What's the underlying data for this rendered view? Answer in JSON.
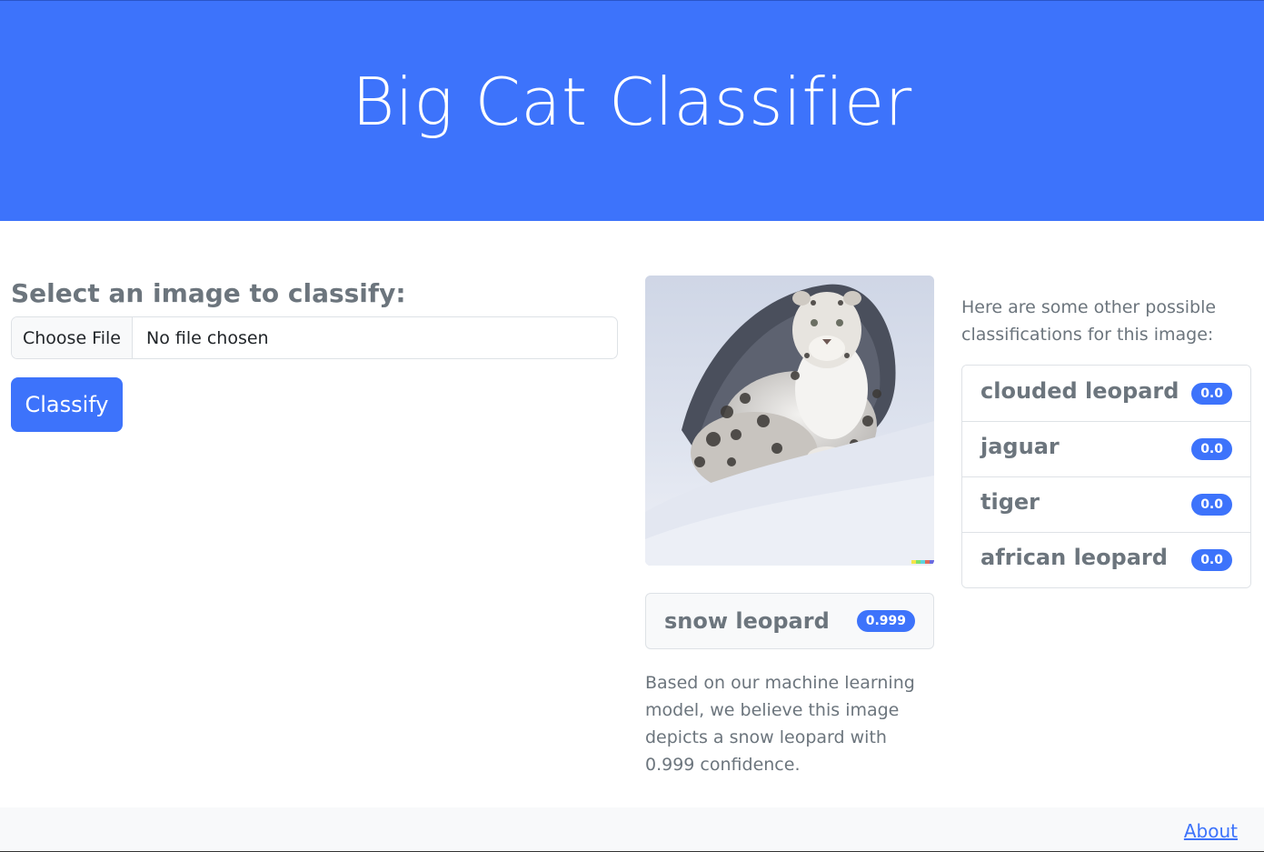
{
  "header": {
    "title": "Big Cat Classifier"
  },
  "upload": {
    "label": "Select an image to classify:",
    "choose_file_label": "Choose File",
    "file_status": "No file chosen",
    "classify_label": "Classify"
  },
  "result": {
    "image_subject": "snow leopard",
    "top_label": "snow leopard",
    "top_score": "0.999",
    "explanation": "Based on our machine learning model, we believe this image depicts a snow leopard with 0.999 confidence."
  },
  "others": {
    "intro": "Here are some other possible classifications for this image:",
    "items": [
      {
        "label": "clouded leopard",
        "score": "0.0"
      },
      {
        "label": "jaguar",
        "score": "0.0"
      },
      {
        "label": "tiger",
        "score": "0.0"
      },
      {
        "label": "african leopard",
        "score": "0.0"
      }
    ]
  },
  "footer": {
    "about_label": "About"
  },
  "colors": {
    "accent": "#3d73fb",
    "muted_text": "#6c757d",
    "footer_bg": "#f8f9fa"
  }
}
